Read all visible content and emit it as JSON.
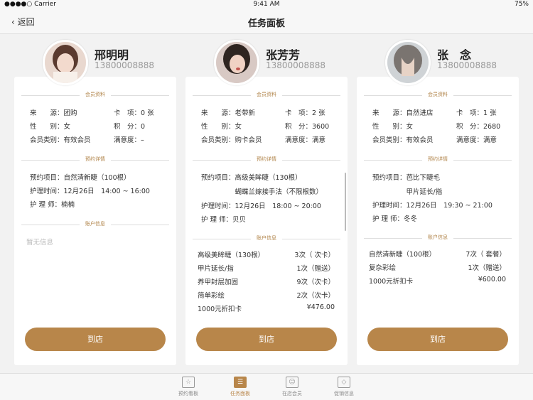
{
  "status": {
    "carrier": "●●●●○ Carrier",
    "time": "9:41 AM",
    "battery": "75%"
  },
  "nav": {
    "back": "返回",
    "title": "任务面板"
  },
  "cards": [
    {
      "name": "邢明明",
      "phone": "13800008888",
      "member_title": "会员资料",
      "source": "来　　源：团购",
      "card": "卡　项：0 张",
      "gender": "性　　别：女",
      "points": "积　分：0",
      "type": "会员类别：有效会员",
      "satisfaction": "满意度：–",
      "booking_title": "预约详情",
      "booking_rows": [
        "预约项目：自然清新睫（100根）",
        "护理时间：12月26日　14:00 ~ 16:00",
        "护 理 师：楠楠"
      ],
      "account_title": "账户信息",
      "account_empty": "暂无信息",
      "account": [],
      "button": "到店"
    },
    {
      "name": "张芳芳",
      "phone": "13800008888",
      "member_title": "会员资料",
      "source": "来　　源：老带新",
      "card": "卡　项：2 张",
      "gender": "性　　别：女",
      "points": "积　分：3600",
      "type": "会员类别：购卡会员",
      "satisfaction": "满意度：满意",
      "booking_title": "预约详情",
      "booking_rows": [
        "预约项目：高级美眸睫（130根）",
        "　　　　　蝴蝶兰嫁接手法（不限根数）",
        "护理时间：12月26日　18:00 ~ 20:00",
        "护 理 师：贝贝"
      ],
      "account_title": "账户信息",
      "account_empty": "",
      "account": [
        {
          "item": "高级美眸睫（130根）",
          "value": "3次（ 次卡）"
        },
        {
          "item": "甲片延长/指",
          "value": "1次（赠送）"
        },
        {
          "item": "养甲封层加固",
          "value": "9次（次卡）"
        },
        {
          "item": "简单彩绘",
          "value": "2次（次卡）"
        },
        {
          "item": "1000元折扣卡",
          "value": "¥476.00"
        }
      ],
      "button": "到店"
    },
    {
      "name": "张　念",
      "phone": "13800008888",
      "member_title": "会员资料",
      "source": "来　　源：自然进店",
      "card": "卡　项：1 张",
      "gender": "性　　别：女",
      "points": "积　分：2680",
      "type": "会员类别：有效会员",
      "satisfaction": "满意度：满意",
      "booking_title": "预约详情",
      "booking_rows": [
        "预约项目：芭比下睫毛",
        "　　　　　甲片延长/指",
        "护理时间：12月26日　19:30 ~ 21:00",
        "护 理 师：冬冬"
      ],
      "account_title": "账户信息",
      "account_empty": "",
      "account": [
        {
          "item": "自然清新睫（100根）",
          "value": "7次（ 套餐）"
        },
        {
          "item": "复杂彩绘",
          "value": "1次（赠送）"
        },
        {
          "item": "1000元折扣卡",
          "value": "¥600.00"
        }
      ],
      "button": "到店"
    }
  ],
  "tabs": [
    {
      "label": "预约看板",
      "icon": "star-icon",
      "active": false
    },
    {
      "label": "任务面板",
      "icon": "list-icon",
      "active": true
    },
    {
      "label": "在店会员",
      "icon": "member-icon",
      "active": false
    },
    {
      "label": "促销信息",
      "icon": "tag-icon",
      "active": false
    }
  ],
  "colors": {
    "accent": "#b8864a",
    "section_title": "#b08348"
  }
}
